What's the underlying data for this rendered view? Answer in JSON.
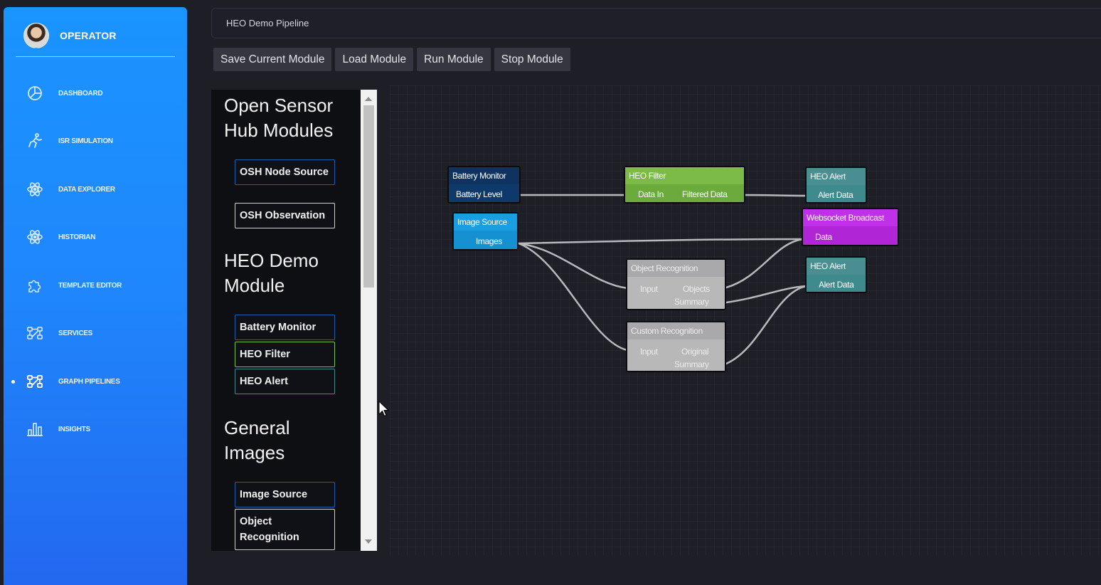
{
  "sidebar": {
    "profile_name": "OPERATOR",
    "items": [
      {
        "label": "DASHBOARD",
        "icon": "pie-chart-icon"
      },
      {
        "label": "ISR SIMULATION",
        "icon": "running-person-icon"
      },
      {
        "label": "DATA EXPLORER",
        "icon": "atom-icon"
      },
      {
        "label": "HISTORIAN",
        "icon": "atom-icon"
      },
      {
        "label": "TEMPLATE EDITOR",
        "icon": "puzzle-icon"
      },
      {
        "label": "SERVICES",
        "icon": "network-icon"
      },
      {
        "label": "GRAPH PIPELINES",
        "icon": "network-icon",
        "active": true
      },
      {
        "label": "INSIGHTS",
        "icon": "bar-chart-icon"
      }
    ]
  },
  "header": {
    "title": "HEO Demo Pipeline"
  },
  "toolbar": {
    "save": "Save Current Module",
    "load": "Load Module",
    "run": "Run Module",
    "stop": "Stop Module"
  },
  "library": {
    "sections": [
      {
        "title_line1": "Open Sensor",
        "title_line2": "Hub Modules",
        "items": [
          {
            "label": "OSH Node Source"
          },
          {
            "label": "OSH Observation"
          }
        ]
      },
      {
        "title_line1": "HEO Demo",
        "title_line2": "Module",
        "items": [
          {
            "label": "Battery Monitor"
          },
          {
            "label": "HEO Filter"
          },
          {
            "label": "HEO Alert"
          }
        ]
      },
      {
        "title_line1": "General",
        "title_line2": "Images",
        "items": [
          {
            "label": "Image Source"
          },
          {
            "label": "Object Recognition"
          }
        ]
      }
    ]
  },
  "graph": {
    "nodes": [
      {
        "title": "Battery Monitor",
        "ports": [
          "Battery Level"
        ],
        "color": "#0d3a6b"
      },
      {
        "title": "HEO Filter",
        "ports": [
          "Data In",
          "Filtered Data"
        ],
        "color": "#6aab3c"
      },
      {
        "title": "HEO Alert",
        "ports": [
          "Alert Data"
        ],
        "color": "#3f8a8c"
      },
      {
        "title": "Image Source",
        "ports": [
          "Images"
        ],
        "color": "#1590d3"
      },
      {
        "title": "Websocket Broadcast",
        "ports": [
          "Data"
        ],
        "color": "#b026d6"
      },
      {
        "title": "Object Recognition",
        "ports": [
          "Input",
          "Objects",
          "Summary"
        ],
        "color": "#b8b8b8"
      },
      {
        "title": "HEO Alert",
        "ports": [
          "Alert Data"
        ],
        "color": "#3f8a8c"
      },
      {
        "title": "Custom Recognition",
        "ports": [
          "Input",
          "Original",
          "Summary"
        ],
        "color": "#b8b8b8"
      }
    ]
  },
  "colors": {
    "sidebar_top": "#1a94ff",
    "sidebar_bottom": "#2368f0",
    "background": "#1d1e26",
    "button": "#353640",
    "lib_border_blue": "#1c5fa8",
    "lib_border_green": "#7cc246",
    "lib_border_white": "#d0d0d0"
  }
}
